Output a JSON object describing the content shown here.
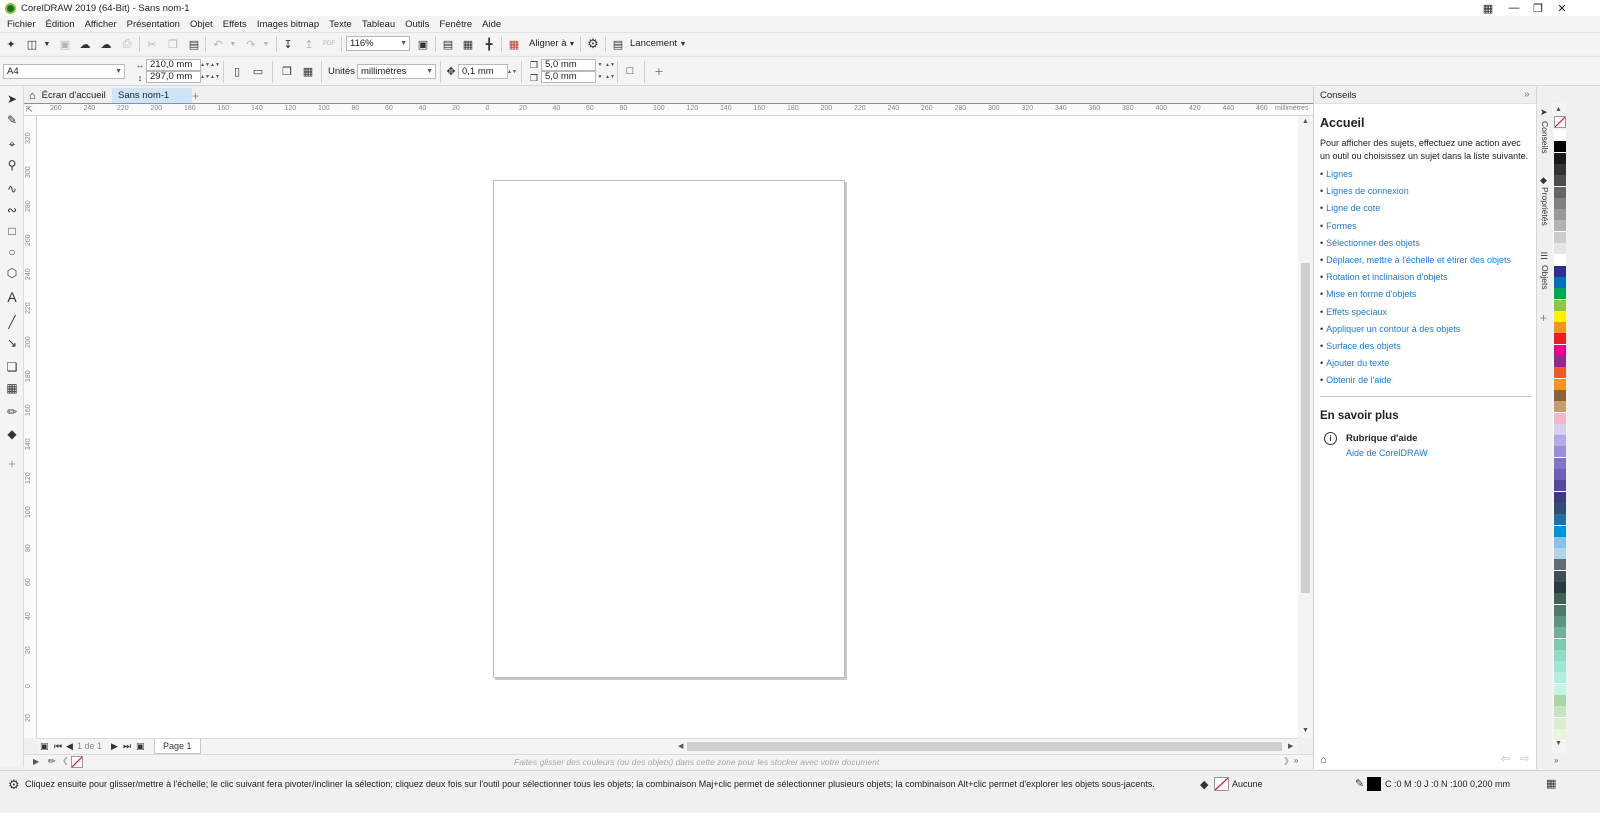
{
  "window": {
    "title": "CorelDRAW 2019 (64-Bit) - Sans nom-1"
  },
  "menu": [
    "Fichier",
    "Édition",
    "Afficher",
    "Présentation",
    "Objet",
    "Effets",
    "Images bitmap",
    "Texte",
    "Tableau",
    "Outils",
    "Fenêtre",
    "Aide"
  ],
  "toolbar": {
    "zoom": "116%",
    "align_label": "Aligner à",
    "launch_label": "Lancement"
  },
  "propbar": {
    "page_size": "A4",
    "width": "210,0 mm",
    "height": "297,0 mm",
    "units_label": "Unités",
    "units_value": "millimètres",
    "nudge": "0,1 mm",
    "dup_x": "5,0 mm",
    "dup_y": "5,0 mm"
  },
  "tabs": {
    "home": "Écran d'accueil",
    "document": "Sans nom-1"
  },
  "ruler": {
    "unit": "millimètres",
    "top_ticks": [
      "260",
      "240",
      "220",
      "200",
      "180",
      "160",
      "140",
      "120",
      "100",
      "80",
      "60",
      "40",
      "20",
      "0",
      "20",
      "40",
      "60",
      "80",
      "100",
      "120",
      "140",
      "160",
      "180",
      "200",
      "220",
      "240",
      "260",
      "280",
      "300",
      "320",
      "340",
      "360",
      "380",
      "400",
      "420",
      "440",
      "460"
    ],
    "left_ticks": [
      "320",
      "300",
      "280",
      "260",
      "240",
      "220",
      "200",
      "180",
      "160",
      "140",
      "120",
      "100",
      "80",
      "60",
      "40",
      "20",
      "0",
      "20"
    ]
  },
  "pagenav": {
    "counter": "1 de 1",
    "page_tab": "Page 1"
  },
  "colorbar": {
    "hint": "Faites glisser des couleurs (ou des objets) dans cette zone pour les stocker avec votre document"
  },
  "status": {
    "message": "Cliquez ensuite pour glisser/mettre à l'échelle; le clic suivant fera pivoter/incliner la sélection; cliquez deux fois sur l'outil pour sélectionner tous les objets; la combinaison Maj+clic permet de sélectionner plusieurs objets; la combinaison Alt+clic permet d'explorer les objets sous-jacents.",
    "fill": "Aucune",
    "outline": "C :0 M :0 J :0 N :100  0,200 mm"
  },
  "docker": {
    "title": "Conseils",
    "heading": "Accueil",
    "intro": "Pour afficher des sujets, effectuez une action avec un outil ou choisissez un sujet dans la liste suivante.",
    "links": [
      "Lignes",
      "Lignes de connexion",
      "Ligne de cote",
      "Formes",
      "Sélectionner des objets",
      "Déplacer, mettre à l'échelle et étirer des objets",
      "Rotation et inclinaison d'objets",
      "Mise en forme d'objets",
      "Effets spéciaux",
      "Appliquer un contour à des objets",
      "Surface des objets",
      "Ajouter du texte",
      "Obtenir de l'aide"
    ],
    "more_heading": "En savoir plus",
    "help_topic": "Rubrique d'aide",
    "help_link": "Aide de CorelDRAW"
  },
  "sidetabs": [
    "Conseils",
    "Propriétés",
    "Objets"
  ],
  "palette_colors": [
    "#ffffff",
    "#000000",
    "#1a1a1a",
    "#333333",
    "#4d4d4d",
    "#666666",
    "#808080",
    "#999999",
    "#b3b3b3",
    "#cccccc",
    "#e6e6e6",
    "#ffffff",
    "#2e3192",
    "#0071bc",
    "#00a651",
    "#8dc63f",
    "#fff200",
    "#f7941d",
    "#ed1c24",
    "#ec008c",
    "#92278f",
    "#f15a24",
    "#f7931e",
    "#8c6239",
    "#c69c6d",
    "#f5b6c8",
    "#d8d0f0",
    "#b7a9e6",
    "#9b8fd9",
    "#7f74c9",
    "#6b5fb8",
    "#524a99",
    "#3f3a80",
    "#2d4f73",
    "#1f6fa8",
    "#0093dd",
    "#88c2e8",
    "#b2d5e8",
    "#5f6e73",
    "#3c4f52",
    "#2b3a3d",
    "#405f55",
    "#4d7a6a",
    "#5e9582",
    "#6eb09c",
    "#7fc8b3",
    "#8fddc7",
    "#9de7d4",
    "#b1efdf",
    "#c2f5e6",
    "#a8d8a8",
    "#c6e6c0",
    "#d9f0d0",
    "#e8f6e0"
  ]
}
